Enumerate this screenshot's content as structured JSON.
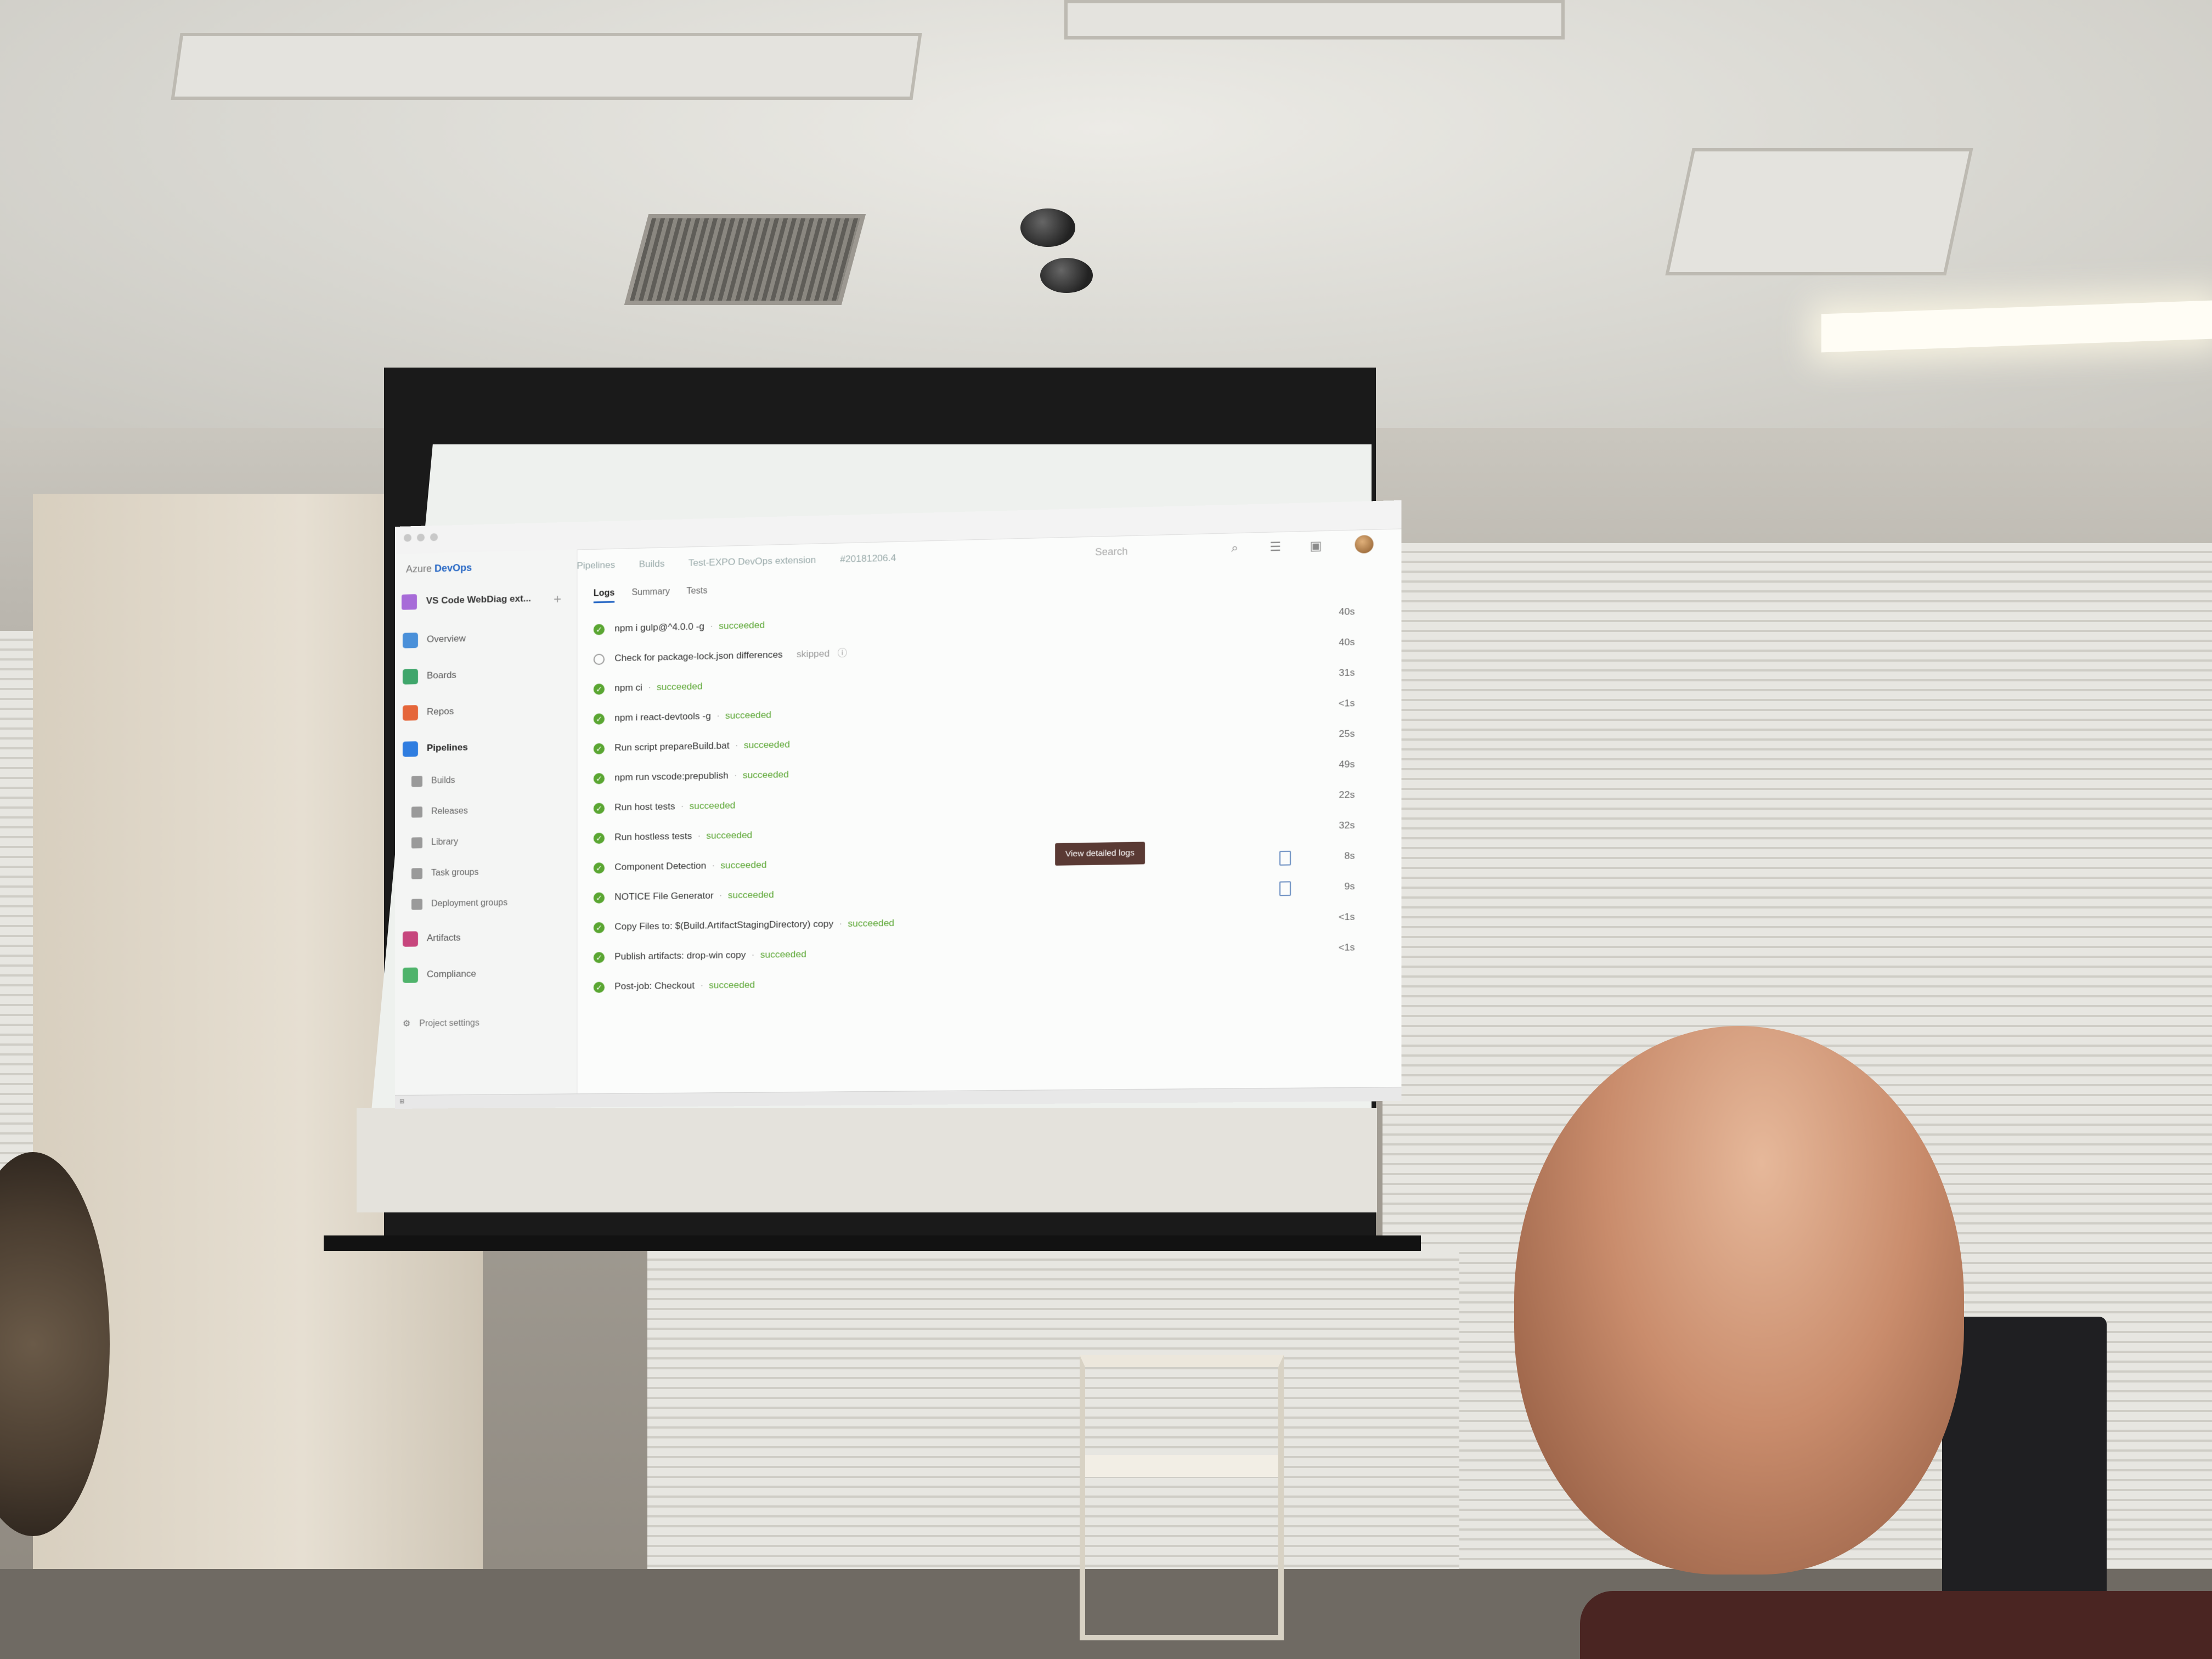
{
  "app": {
    "brand_prefix": "Azure",
    "brand_name": "DevOps"
  },
  "breadcrumbs": [
    "Pipelines",
    "Builds",
    "Test-EXPO DevOps extension",
    "#20181206.4"
  ],
  "search": {
    "label": "Search"
  },
  "project": {
    "name": "VS Code WebDiag ext..."
  },
  "sidebar": {
    "items": [
      {
        "label": "Overview",
        "icon": "overview-icon",
        "color": "#4a90d9"
      },
      {
        "label": "Boards",
        "icon": "boards-icon",
        "color": "#3fa66b"
      },
      {
        "label": "Repos",
        "icon": "repos-icon",
        "color": "#e5663a"
      },
      {
        "label": "Pipelines",
        "icon": "pipelines-icon",
        "color": "#2f7de0"
      },
      {
        "label": "Builds",
        "icon": "builds-icon"
      },
      {
        "label": "Releases",
        "icon": "releases-icon"
      },
      {
        "label": "Library",
        "icon": "library-icon"
      },
      {
        "label": "Task groups",
        "icon": "task-groups-icon"
      },
      {
        "label": "Deployment groups",
        "icon": "deployment-groups-icon"
      },
      {
        "label": "Artifacts",
        "icon": "artifacts-icon",
        "color": "#c7467d"
      },
      {
        "label": "Compliance",
        "icon": "compliance-icon",
        "color": "#4fb36b"
      }
    ],
    "settings_label": "Project settings"
  },
  "tabs": [
    "Logs",
    "Summary",
    "Tests"
  ],
  "steps": [
    {
      "name": "npm i gulp@^4.0.0 -g",
      "status": "succeeded",
      "duration": "40s"
    },
    {
      "name": "Check for package-lock.json differences",
      "status": "skipped",
      "duration": "40s"
    },
    {
      "name": "npm ci",
      "status": "succeeded",
      "duration": "31s"
    },
    {
      "name": "npm i react-devtools -g",
      "status": "succeeded",
      "duration": "<1s"
    },
    {
      "name": "Run script prepareBuild.bat",
      "status": "succeeded",
      "duration": "25s"
    },
    {
      "name": "npm run vscode:prepublish",
      "status": "succeeded",
      "duration": "49s"
    },
    {
      "name": "Run host tests",
      "status": "succeeded",
      "duration": "22s"
    },
    {
      "name": "Run hostless tests",
      "status": "succeeded",
      "duration": "32s"
    },
    {
      "name": "Component Detection",
      "status": "succeeded",
      "duration": "8s"
    },
    {
      "name": "NOTICE File Generator",
      "status": "succeeded",
      "duration": "9s"
    },
    {
      "name": "Copy Files to: $(Build.ArtifactStagingDirectory) copy",
      "status": "succeeded",
      "duration": "<1s"
    },
    {
      "name": "Publish artifacts: drop-win copy",
      "status": "succeeded",
      "duration": "<1s"
    },
    {
      "name": "Post-job: Checkout",
      "status": "succeeded",
      "duration": ""
    }
  ],
  "tooltip": {
    "text": "View detailed logs"
  },
  "colors": {
    "success": "#5aa632",
    "accent": "#2566c4"
  }
}
